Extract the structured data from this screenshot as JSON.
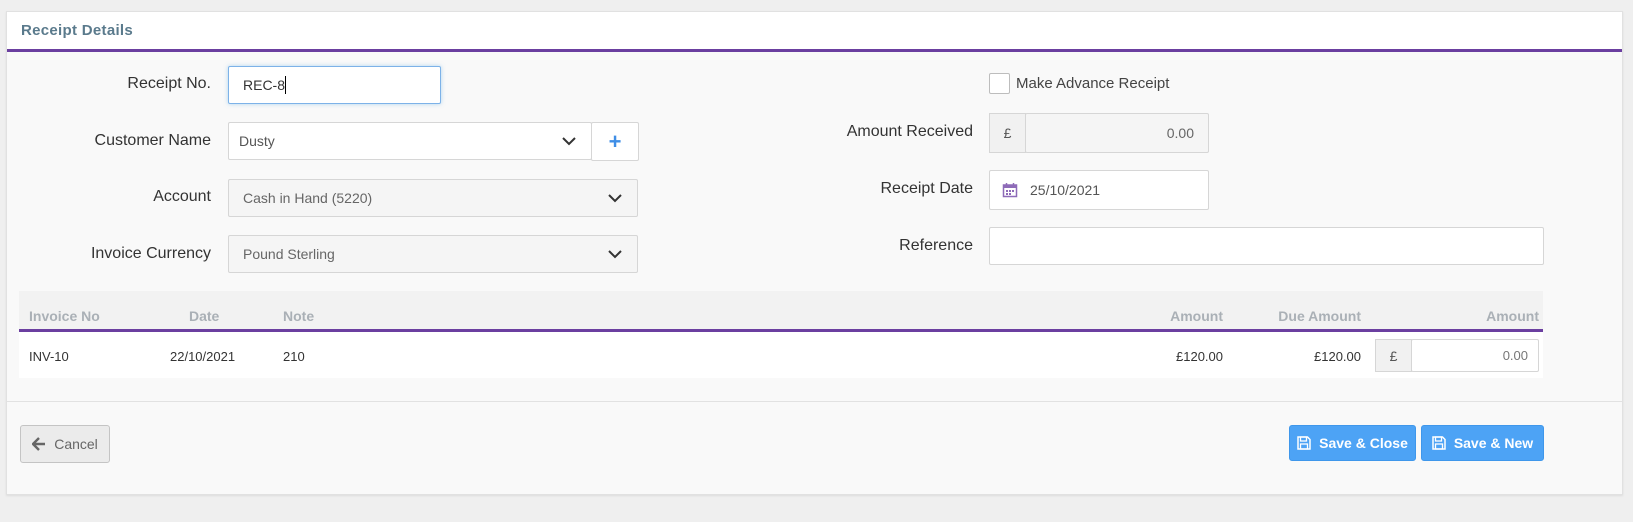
{
  "panel": {
    "title": "Receipt Details"
  },
  "form": {
    "receipt_no": {
      "label": "Receipt No.",
      "value": "REC-8"
    },
    "customer_name": {
      "label": "Customer Name",
      "value": "Dusty",
      "add_symbol": "+"
    },
    "account": {
      "label": "Account",
      "value": "Cash in Hand (5220)"
    },
    "invoice_currency": {
      "label": "Invoice Currency",
      "value": "Pound Sterling"
    },
    "advance_receipt": {
      "label": "Make Advance Receipt",
      "checked": false
    },
    "amount_received": {
      "label": "Amount Received",
      "currency_symbol": "£",
      "value": "0.00"
    },
    "receipt_date": {
      "label": "Receipt Date",
      "value": "25/10/2021"
    },
    "reference": {
      "label": "Reference",
      "value": ""
    }
  },
  "table": {
    "headers": {
      "invoice_no": "Invoice No",
      "date": "Date",
      "note": "Note",
      "amount": "Amount",
      "due_amount": "Due Amount",
      "pay_amount": "Amount"
    },
    "rows": [
      {
        "invoice_no": "INV-10",
        "date": "22/10/2021",
        "note": "210",
        "amount": "£120.00",
        "due_amount": "£120.00",
        "currency_symbol": "£",
        "pay_amount": "0.00"
      }
    ]
  },
  "footer": {
    "cancel_label": "Cancel",
    "save_close_label": "Save & Close",
    "save_new_label": "Save & New"
  },
  "colors": {
    "accent": "#6b3fa0",
    "primary_button": "#4da3f5",
    "add_icon": "#3f8ee6",
    "calendar_icon": "#8e6bb8"
  },
  "icons": {
    "add": "plus-icon",
    "dropdown": "chevron-down-icon",
    "calendar": "calendar-icon",
    "back": "arrow-left-icon",
    "save": "floppy-disk-icon"
  }
}
